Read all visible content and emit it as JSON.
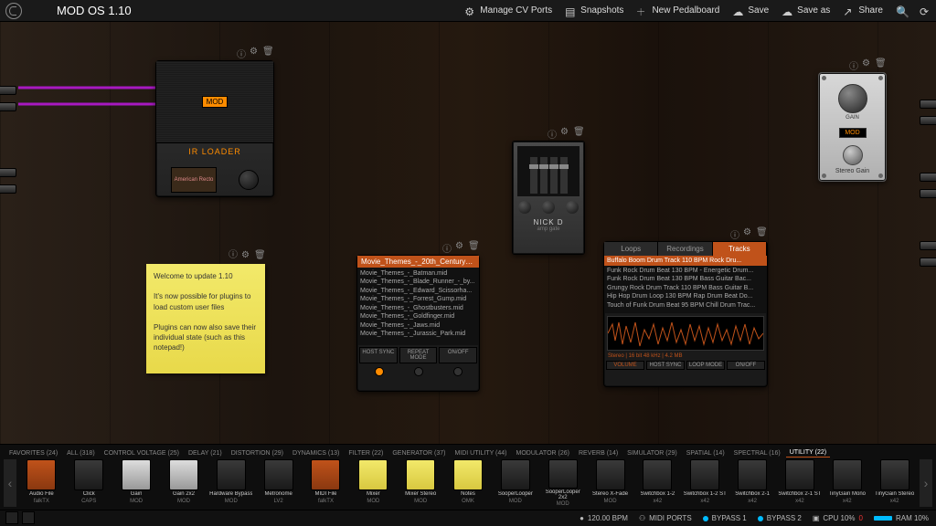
{
  "app": {
    "title": "MOD OS 1.10"
  },
  "topbar": {
    "manage_cv": "Manage CV Ports",
    "snapshots": "Snapshots",
    "new_board": "New Pedalboard",
    "save": "Save",
    "save_as": "Save as",
    "share": "Share"
  },
  "ir_loader": {
    "badge": "MOD",
    "label": "IR LOADER",
    "slot": "American Recto"
  },
  "sticky": {
    "line1": "Welcome to update 1.10",
    "line2": "It's now possible for plugins to load custom user files",
    "line3": "Plugins can now also save their individual state (such as this notepad!)"
  },
  "midi_player": {
    "title": "Movie_Themes_-_20th_Century_Fo...",
    "items": [
      "Movie_Themes_-_Batman.mid",
      "Movie_Themes_-_Blade_Runner_-_by...",
      "Movie_Themes_-_Edward_Scissorha...",
      "Movie_Themes_-_Forrest_Gump.mid",
      "Movie_Themes_-_Ghostbusters.mid",
      "Movie_Themes_-_Goldfinger.mid",
      "Movie_Themes_-_Jaws.mid",
      "Movie_Themes_-_Jurassic_Park.mid"
    ],
    "ctrl1": "HOST SYNC",
    "ctrl2": "REPEAT MODE",
    "ctrl3": "ON/OFF"
  },
  "nickd": {
    "label": "NICK D",
    "sub": "amp gate"
  },
  "audio_player": {
    "tabs": [
      "Loops",
      "Recordings",
      "Tracks"
    ],
    "active_tab": 2,
    "selected": "Buffalo Boom Drum Track 110 BPM Rock Dru...",
    "items": [
      "Funk Rock Drum Beat 130 BPM - Energetic Drum...",
      "Funk Rock Drum Beat 130 BPM Bass Guitar Bac...",
      "Grungy Rock Drum Track 110 BPM Bass Guitar B...",
      "Hip Hop Drum Loop 130 BPM Rap Drum Beat Do...",
      "Touch of Funk Drum Beat 95 BPM Chill Drum Trac..."
    ],
    "info": "Stereo | 16 bit  48 kHz | 4.2 MB",
    "c_vol": "VOLUME",
    "c_sync": "HOST SYNC",
    "c_loop": "LOOP MODE",
    "c_on": "ON/OFF"
  },
  "stereo_gain": {
    "knob_label": "GAIN",
    "badge": "MOD",
    "label": "Stereo Gain"
  },
  "browser": {
    "tabs": [
      "FAVORITES (24)",
      "ALL (318)",
      "CONTROL VOLTAGE (25)",
      "DELAY (21)",
      "DISTORTION (29)",
      "DYNAMICS (13)",
      "FILTER (22)",
      "GENERATOR (37)",
      "MIDI UTILITY (44)",
      "MODULATOR (26)",
      "REVERB (14)",
      "SIMULATOR (29)",
      "SPATIAL (14)",
      "SPECTRAL (16)",
      "UTILITY (22)"
    ],
    "active_tab": 14,
    "plugins": [
      {
        "name": "Audio File",
        "vendor": "falkTX",
        "cls": "or"
      },
      {
        "name": "Click",
        "vendor": "CAPS",
        "cls": ""
      },
      {
        "name": "Gain",
        "vendor": "MOD",
        "cls": "lt"
      },
      {
        "name": "Gain 2x2",
        "vendor": "MOD",
        "cls": "lt"
      },
      {
        "name": "Hardware Bypass",
        "vendor": "MOD",
        "cls": ""
      },
      {
        "name": "Metronome",
        "vendor": "LV2",
        "cls": ""
      },
      {
        "name": "MIDI File",
        "vendor": "falkTX",
        "cls": "or"
      },
      {
        "name": "Mixer",
        "vendor": "MOD",
        "cls": "yl"
      },
      {
        "name": "Mixer Stereo",
        "vendor": "MOD",
        "cls": "yl"
      },
      {
        "name": "Notes",
        "vendor": "OMK",
        "cls": "yl"
      },
      {
        "name": "SooperLooper",
        "vendor": "MOD",
        "cls": ""
      },
      {
        "name": "SooperLooper 2x2",
        "vendor": "MOD",
        "cls": ""
      },
      {
        "name": "Stereo X-Fade",
        "vendor": "MOD",
        "cls": ""
      },
      {
        "name": "Switchbox 1-2",
        "vendor": "x42",
        "cls": ""
      },
      {
        "name": "Switchbox 1-2 ST",
        "vendor": "x42",
        "cls": ""
      },
      {
        "name": "Switchbox 2-1",
        "vendor": "x42",
        "cls": ""
      },
      {
        "name": "Switchbox 2-1 ST",
        "vendor": "x42",
        "cls": ""
      },
      {
        "name": "TinyGain Mono",
        "vendor": "x42",
        "cls": ""
      },
      {
        "name": "TinyGain Stereo",
        "vendor": "x42",
        "cls": ""
      }
    ]
  },
  "status": {
    "bpm": "120.00 BPM",
    "midi": "MIDI PORTS",
    "bypass1": "BYPASS 1",
    "bypass2": "BYPASS 2",
    "cpu": "CPU 10%",
    "xruns": "0",
    "ram": "RAM 10%"
  }
}
